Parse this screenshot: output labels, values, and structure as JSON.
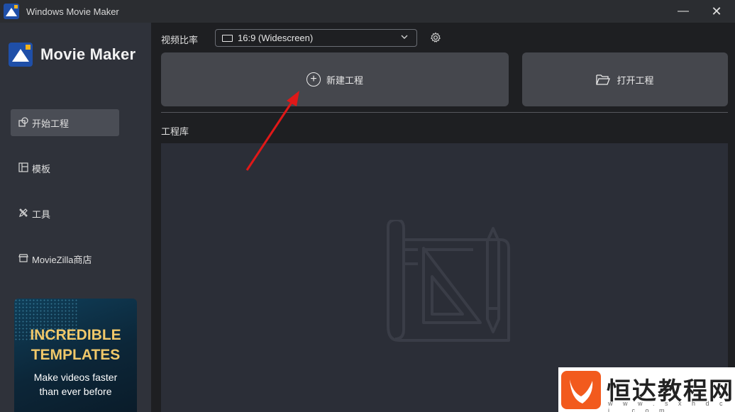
{
  "window": {
    "title": "Windows Movie Maker",
    "minimize_glyph": "—",
    "close_glyph": "✕"
  },
  "sidebar": {
    "brand": "Movie Maker",
    "items": [
      {
        "label": "开始工程",
        "icon": "shapes-icon",
        "active": true
      },
      {
        "label": "模板",
        "icon": "template-icon",
        "active": false
      },
      {
        "label": "工具",
        "icon": "toolbox-icon",
        "active": false
      },
      {
        "label": "MovieZilla商店",
        "icon": "store-icon",
        "active": false
      }
    ],
    "promo": {
      "headline_line1": "INCREDIBLE",
      "headline_line2": "TEMPLATES",
      "sub_line1": "Make videos faster",
      "sub_line2": "than ever before"
    }
  },
  "main": {
    "ratio_label": "视频比率",
    "ratio_value": "16:9 (Widescreen)",
    "new_project_label": "新建工程",
    "open_project_label": "打开工程",
    "library_label": "工程库"
  },
  "watermark": {
    "text": "恒达教程网",
    "url": "w w w . s x h d c j . c o m"
  },
  "colors": {
    "sidebar_bg": "#2f323a",
    "main_bg": "#1e1f22",
    "button_bg": "#45474d",
    "library_bg": "#2b2e37",
    "brand_blue": "#1f4fa8",
    "arrow_red": "#e01818"
  }
}
